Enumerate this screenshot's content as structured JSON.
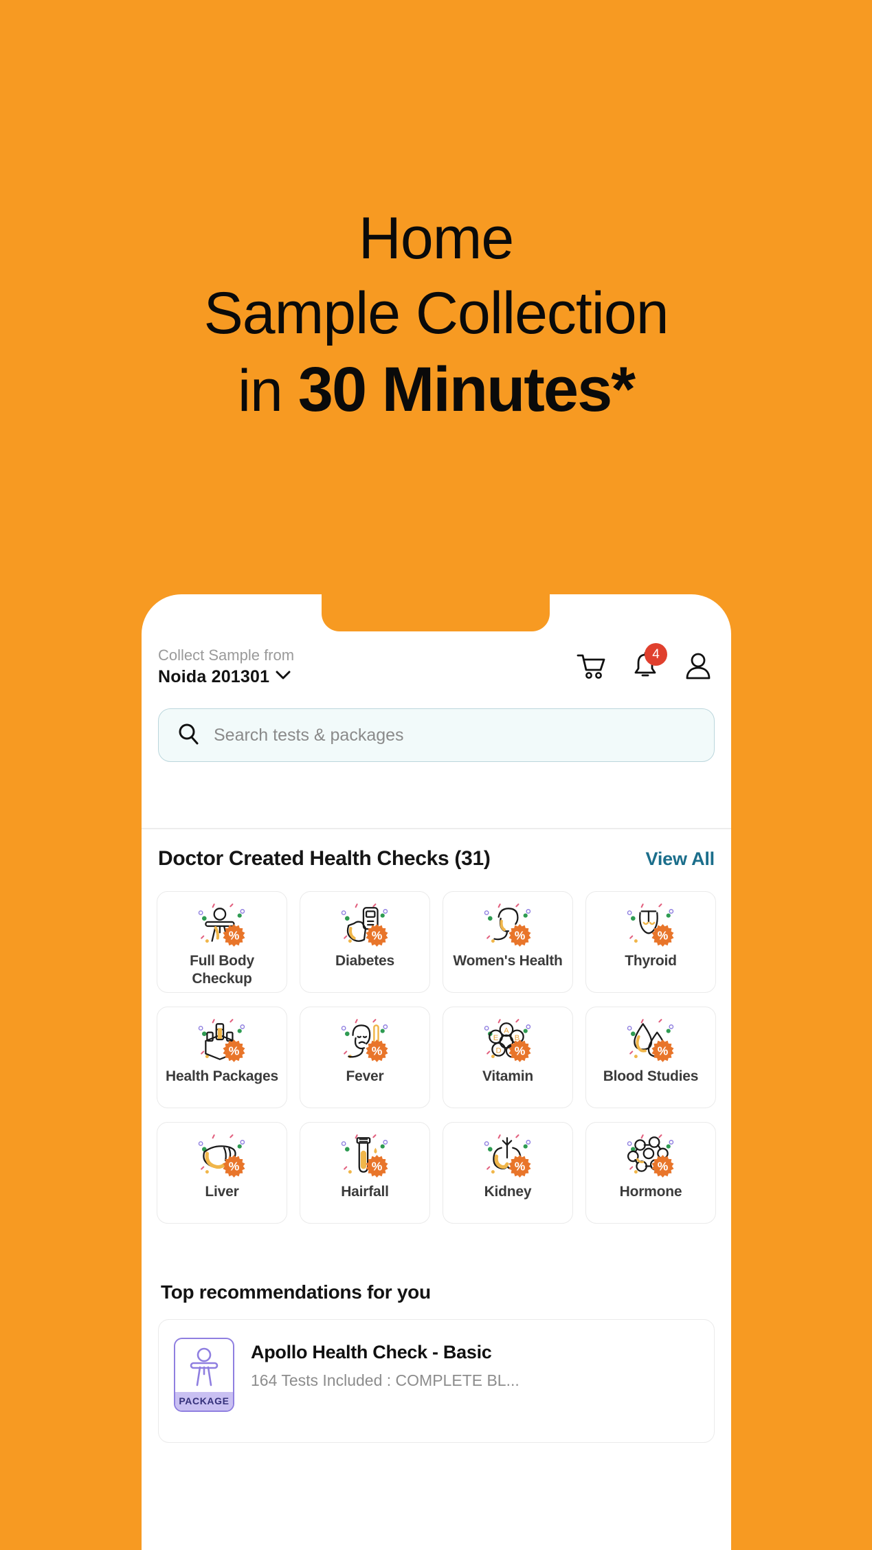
{
  "hero": {
    "line1": "Home",
    "line2": "Sample Collection",
    "line3_prefix": "in ",
    "line3_bold": "30 Minutes*",
    "background_color": "#F79A22"
  },
  "app": {
    "header": {
      "location_label": "Collect Sample from",
      "location_value": "Noida  201301",
      "chevron_icon": "chevron-down-icon",
      "cart_icon": "shopping-cart-icon",
      "notification_icon": "bell-icon",
      "notification_count": "4",
      "profile_icon": "user-icon",
      "badge_color": "#E0402E"
    },
    "search": {
      "icon": "search-icon",
      "placeholder": "Search tests & packages"
    },
    "health_checks": {
      "title": "Doctor Created Health Checks (31)",
      "view_all_label": "View All",
      "view_all_color": "#1B6E8B",
      "categories": [
        {
          "label": "Full Body Checkup",
          "icon": "full-body-checkup-icon",
          "badge": "%"
        },
        {
          "label": "Diabetes",
          "icon": "diabetes-glucometer-icon",
          "badge": "%"
        },
        {
          "label": "Women's Health",
          "icon": "womens-health-icon",
          "badge": "%"
        },
        {
          "label": "Thyroid",
          "icon": "thyroid-gland-icon",
          "badge": "%"
        },
        {
          "label": "Health Packages",
          "icon": "health-packages-box-icon",
          "badge": "%"
        },
        {
          "label": "Fever",
          "icon": "fever-thermometer-icon",
          "badge": "%"
        },
        {
          "label": "Vitamin",
          "icon": "vitamin-icon",
          "badge": "%"
        },
        {
          "label": "Blood Studies",
          "icon": "blood-drop-icon",
          "badge": "%"
        },
        {
          "label": "Liver",
          "icon": "liver-icon",
          "badge": "%"
        },
        {
          "label": "Hairfall",
          "icon": "test-tube-icon",
          "badge": "%"
        },
        {
          "label": "Kidney",
          "icon": "kidney-icon",
          "badge": "%"
        },
        {
          "label": "Hormone",
          "icon": "hormone-molecule-icon",
          "badge": "%"
        }
      ]
    },
    "recommendations": {
      "title": "Top recommendations for you",
      "items": [
        {
          "thumb_icon": "package-person-icon",
          "thumb_tag": "PACKAGE",
          "name": "Apollo Health Check - Basic",
          "subtitle": "164 Tests Included : COMPLETE BL..."
        }
      ]
    }
  }
}
